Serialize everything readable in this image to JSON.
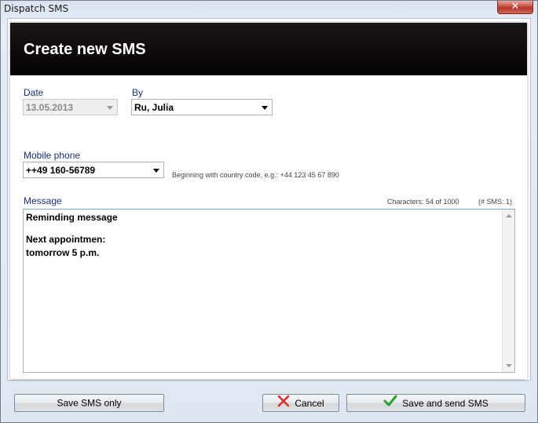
{
  "window": {
    "title": "Dispatch SMS",
    "close_glyph": "✕"
  },
  "header": {
    "title": "Create new SMS"
  },
  "date": {
    "label": "Date",
    "value": "13.05.2013"
  },
  "by": {
    "label": "By",
    "value": "Ru, Julia"
  },
  "mobile": {
    "label": "Mobile phone",
    "value": "++49 160-56789",
    "hint": "Beginning with country code, e.g.: +44 123 45 67 890"
  },
  "message": {
    "label": "Message",
    "char_count": "Characters: 54 of 1000",
    "sms_count": "(# SMS: 1)",
    "lines": [
      "Reminding message",
      "",
      "Next appointmen:",
      "tomorrow 5 p.m."
    ]
  },
  "buttons": {
    "save_only": "Save SMS only",
    "cancel": "Cancel",
    "save_send": "Save and send SMS"
  },
  "icons": {
    "cancel": "red-x-icon",
    "save_send": "green-check-icon"
  },
  "colors": {
    "label": "#1a2d7a",
    "header_bg": "#050304",
    "cancel_icon": "#d9302a",
    "check_icon": "#2aa02a"
  }
}
